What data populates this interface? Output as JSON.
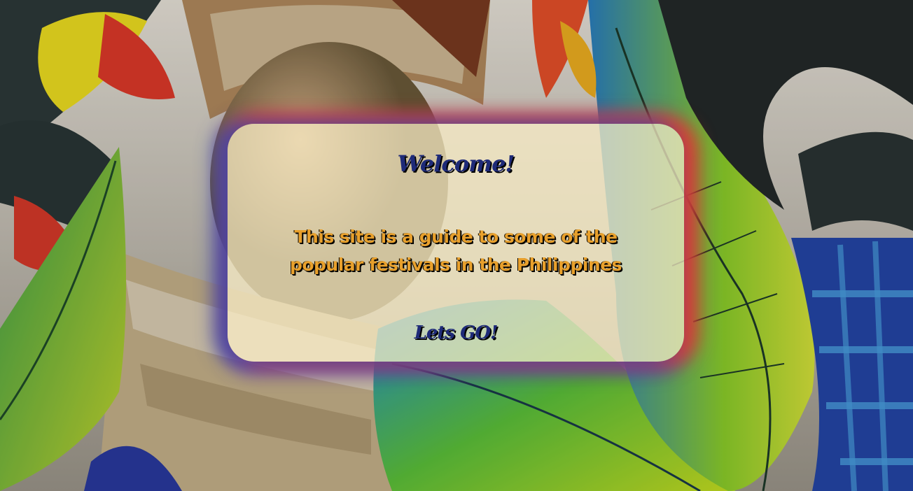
{
  "background": {
    "description_icon": "festival-photo-background"
  },
  "card": {
    "title": "Welcome!",
    "description": "This site is a guide to some of the popular festivals in the Philippines",
    "cta_label": "Lets GO!"
  },
  "colors": {
    "title": "#1e2a78",
    "description": "#e8a02c",
    "card_fill": "#fcf0c8",
    "glow_left": "#3c46aa",
    "glow_right": "#eb3c28"
  }
}
